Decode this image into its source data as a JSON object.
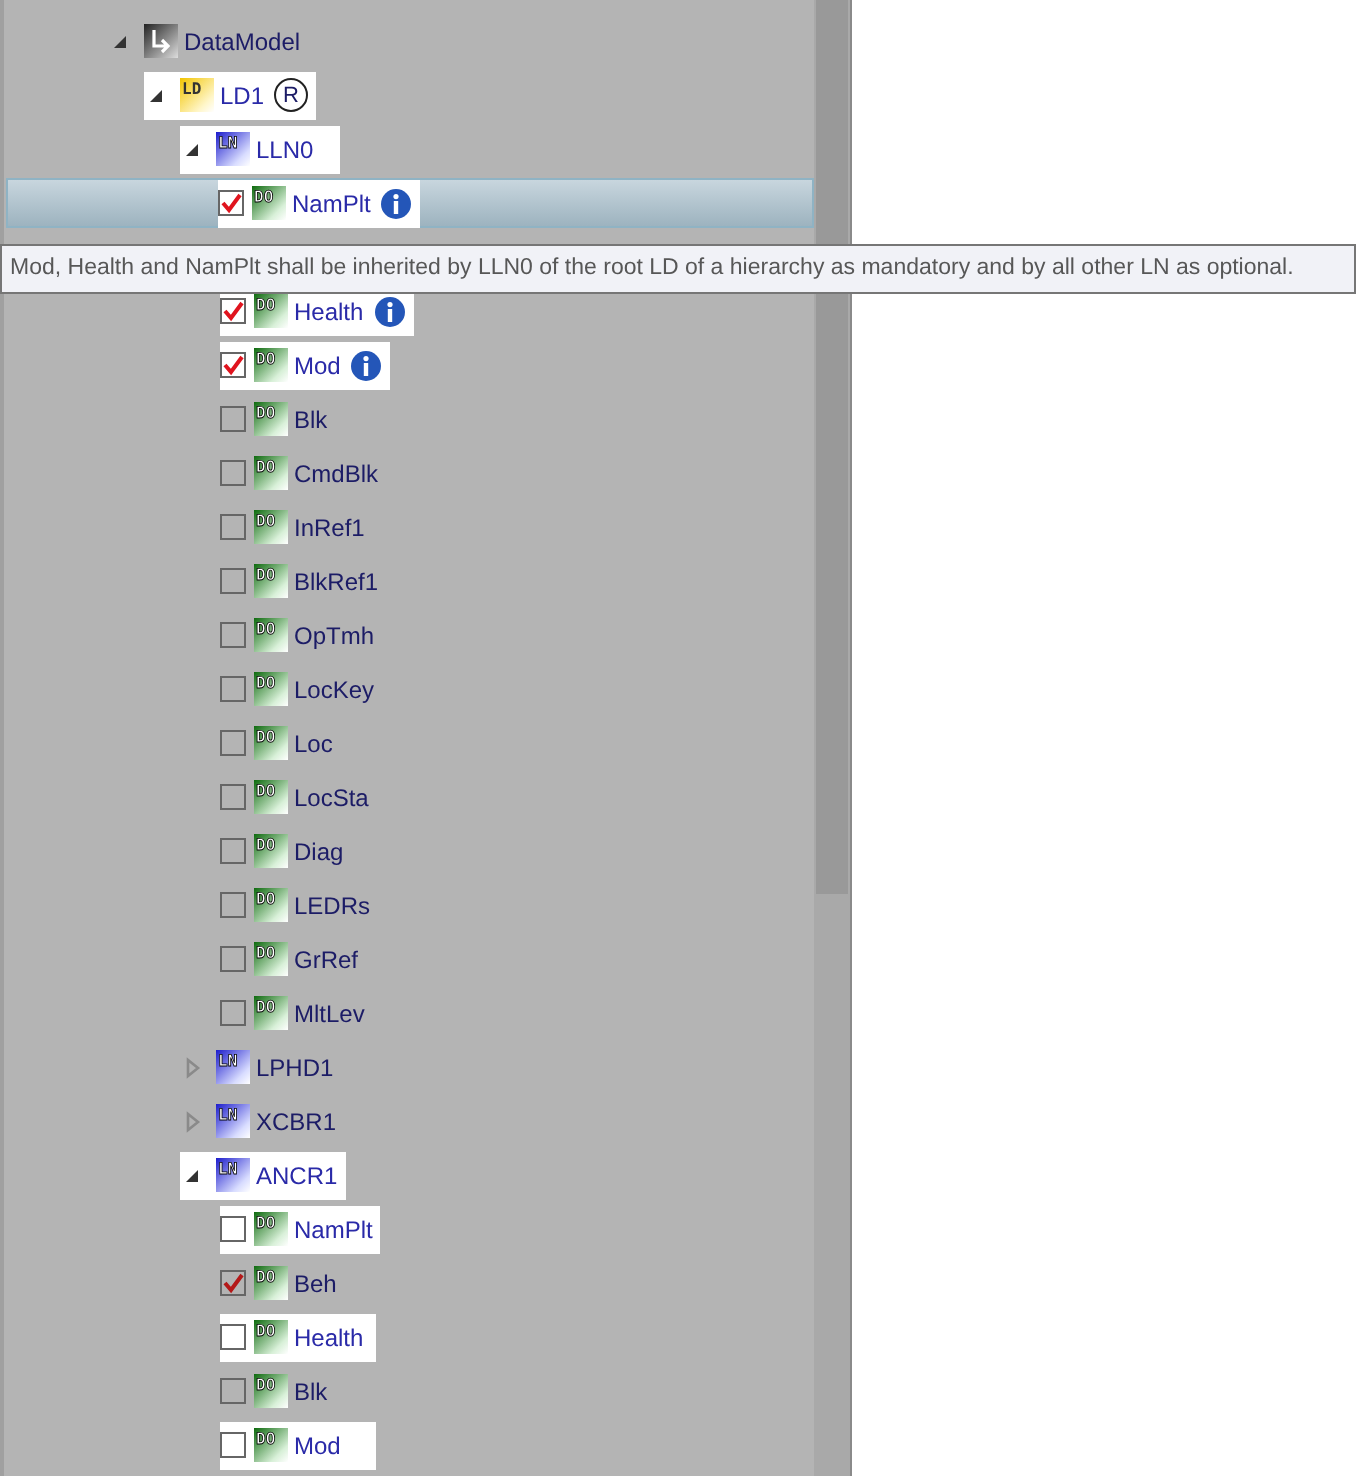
{
  "tree": [
    {
      "kind": "root",
      "label": "DataModel",
      "expanded": true,
      "selected": false,
      "highlighted": false,
      "children": [
        {
          "kind": "ld",
          "icon_text": "LD",
          "label": "LD1",
          "badge": "R",
          "expanded": true,
          "selected": false,
          "highlighted": true,
          "children": [
            {
              "kind": "ln",
              "icon_text": "LN",
              "label": "LLN0",
              "expanded": true,
              "selected": false,
              "highlighted": true,
              "children": [
                {
                  "kind": "do",
                  "icon_text": "DO",
                  "label": "NamPlt",
                  "checked": true,
                  "info": true,
                  "selected": true,
                  "highlighted": true,
                  "tooltip": "Mod, Health and NamPlt shall be inherited by LLN0 of the root LD of a hierarchy as mandatory and by all other LN as optional."
                },
                {
                  "kind": "do",
                  "icon_text": "DO",
                  "label": "Health",
                  "checked": true,
                  "info": true,
                  "selected": false,
                  "highlighted": true
                },
                {
                  "kind": "do",
                  "icon_text": "DO",
                  "label": "Mod",
                  "checked": true,
                  "info": true,
                  "selected": false,
                  "highlighted": true
                },
                {
                  "kind": "do",
                  "icon_text": "DO",
                  "label": "Blk",
                  "checked": false,
                  "info": false,
                  "selected": false,
                  "highlighted": false
                },
                {
                  "kind": "do",
                  "icon_text": "DO",
                  "label": "CmdBlk",
                  "checked": false,
                  "info": false,
                  "selected": false,
                  "highlighted": false
                },
                {
                  "kind": "do",
                  "icon_text": "DO",
                  "label": "InRef1",
                  "checked": false,
                  "info": false,
                  "selected": false,
                  "highlighted": false
                },
                {
                  "kind": "do",
                  "icon_text": "DO",
                  "label": "BlkRef1",
                  "checked": false,
                  "info": false,
                  "selected": false,
                  "highlighted": false
                },
                {
                  "kind": "do",
                  "icon_text": "DO",
                  "label": "OpTmh",
                  "checked": false,
                  "info": false,
                  "selected": false,
                  "highlighted": false
                },
                {
                  "kind": "do",
                  "icon_text": "DO",
                  "label": "LocKey",
                  "checked": false,
                  "info": false,
                  "selected": false,
                  "highlighted": false
                },
                {
                  "kind": "do",
                  "icon_text": "DO",
                  "label": "Loc",
                  "checked": false,
                  "info": false,
                  "selected": false,
                  "highlighted": false
                },
                {
                  "kind": "do",
                  "icon_text": "DO",
                  "label": "LocSta",
                  "checked": false,
                  "info": false,
                  "selected": false,
                  "highlighted": false
                },
                {
                  "kind": "do",
                  "icon_text": "DO",
                  "label": "Diag",
                  "checked": false,
                  "info": false,
                  "selected": false,
                  "highlighted": false
                },
                {
                  "kind": "do",
                  "icon_text": "DO",
                  "label": "LEDRs",
                  "checked": false,
                  "info": false,
                  "selected": false,
                  "highlighted": false
                },
                {
                  "kind": "do",
                  "icon_text": "DO",
                  "label": "GrRef",
                  "checked": false,
                  "info": false,
                  "selected": false,
                  "highlighted": false
                },
                {
                  "kind": "do",
                  "icon_text": "DO",
                  "label": "MltLev",
                  "checked": false,
                  "info": false,
                  "selected": false,
                  "highlighted": false
                }
              ]
            },
            {
              "kind": "ln",
              "icon_text": "LN",
              "label": "LPHD1",
              "expanded": false,
              "selected": false,
              "highlighted": false
            },
            {
              "kind": "ln",
              "icon_text": "LN",
              "label": "XCBR1",
              "expanded": false,
              "selected": false,
              "highlighted": false
            },
            {
              "kind": "ln",
              "icon_text": "LN",
              "label": "ANCR1",
              "expanded": true,
              "selected": false,
              "highlighted": true,
              "children": [
                {
                  "kind": "do",
                  "icon_text": "DO",
                  "label": "NamPlt",
                  "checked": false,
                  "info": false,
                  "selected": false,
                  "highlighted": true
                },
                {
                  "kind": "do",
                  "icon_text": "DO",
                  "label": "Beh",
                  "checked": true,
                  "info": false,
                  "selected": false,
                  "highlighted": false
                },
                {
                  "kind": "do",
                  "icon_text": "DO",
                  "label": "Health",
                  "checked": false,
                  "info": false,
                  "selected": false,
                  "highlighted": true
                },
                {
                  "kind": "do",
                  "icon_text": "DO",
                  "label": "Blk",
                  "checked": false,
                  "info": false,
                  "selected": false,
                  "highlighted": false
                },
                {
                  "kind": "do",
                  "icon_text": "DO",
                  "label": "Mod",
                  "checked": false,
                  "info": false,
                  "selected": false,
                  "highlighted": true
                }
              ]
            }
          ]
        }
      ]
    }
  ]
}
